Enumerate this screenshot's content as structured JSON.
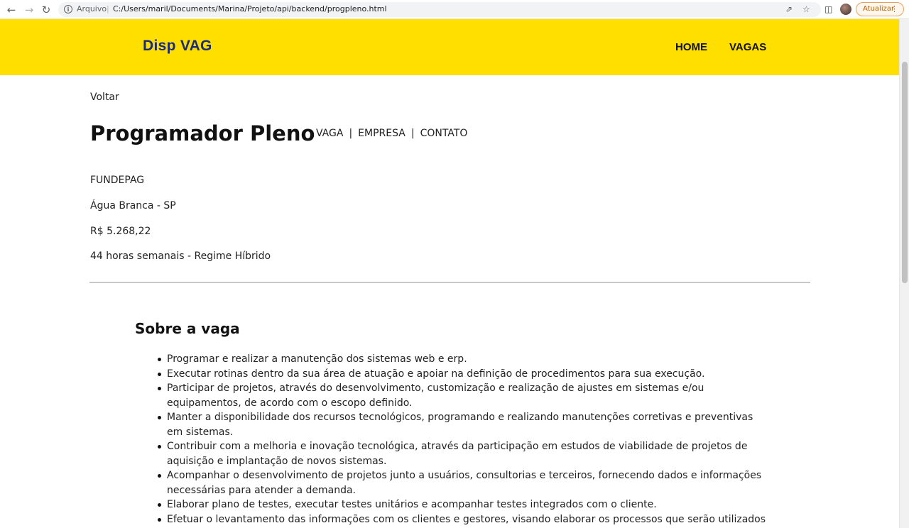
{
  "browser": {
    "file_label": "Arquivo",
    "url": "C:/Users/maril/Documents/Marina/Projeto/api/backend/progpleno.html",
    "update_label": "Atualizar"
  },
  "header": {
    "logo": "Disp VAG",
    "nav": [
      "HOME",
      "VAGAS"
    ]
  },
  "page": {
    "back": "Voltar",
    "title": "Programador Pleno",
    "sub_nav": [
      "VAGA",
      "EMPRESA",
      "CONTATO"
    ],
    "sub_nav_separator": "|",
    "company": "FUNDEPAG",
    "location": "Água Branca - SP",
    "salary": "R$ 5.268,22",
    "hours": "44 horas semanais - Regime Híbrido"
  },
  "about": {
    "title": "Sobre a vaga",
    "items": [
      "Programar e realizar a manutenção dos sistemas web e erp.",
      "Executar rotinas dentro da sua área de atuação e apoiar na definição de procedimentos para sua execução.",
      "Participar de projetos, através do desenvolvimento, customização e realização de ajustes em sistemas e/ou equipamentos, de acordo com o escopo definido.",
      "Manter a disponibilidade dos recursos tecnológicos, programando e realizando manutenções corretivas e preventivas em sistemas.",
      "Contribuir com a melhoria e inovação tecnológica, através da participação em estudos de viabilidade de projetos de aquisição e implantação de novos sistemas.",
      "Acompanhar o desenvolvimento de projetos junto a usuários, consultorias e terceiros, fornecendo dados e informações necessárias para atender a demanda.",
      "Elaborar plano de testes, executar testes unitários e acompanhar testes integrados com o cliente.",
      "Efetuar o levantamento das informações com os clientes e gestores, visando elaborar os processos que serão utilizados no"
    ]
  },
  "colors": {
    "header_bg": "#ffdf00",
    "logo": "#1c2a7a"
  },
  "icons": [
    "back-arrow-icon",
    "forward-arrow-icon",
    "reload-icon",
    "info-icon",
    "share-icon",
    "star-icon",
    "sidepanel-icon",
    "more-vert-icon"
  ]
}
